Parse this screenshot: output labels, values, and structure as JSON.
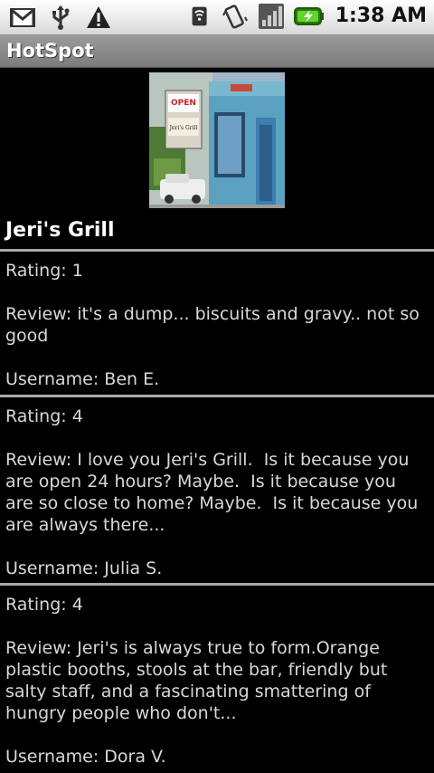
{
  "status_bar": {
    "icons": [
      "gmail-icon",
      "usb-icon",
      "warning-icon",
      "wifi-icon",
      "vibrate-icon",
      "signal-icon",
      "battery-icon"
    ],
    "time": "1:38 AM"
  },
  "app": {
    "title": "HotSpot"
  },
  "place": {
    "name": "Jeri's Grill",
    "photo_sign_1": "OPEN",
    "photo_sign_2": "Jeri's Grill"
  },
  "reviews": [
    {
      "rating": "Rating: 1",
      "review": "Review: it's a dump... biscuits and gravy.. not so good",
      "username": "Username: Ben E."
    },
    {
      "rating": "Rating: 4",
      "review": "Review: I love you Jeri's Grill.  Is it because you are open 24 hours? Maybe.  Is it because you are so close to home? Maybe.  Is it because you are always there...",
      "username": "Username: Julia S."
    },
    {
      "rating": "Rating: 4",
      "review": "Review: Jeri's is always true to form.Orange plastic booths, stools at the bar, friendly but salty staff, and a fascinating smattering of hungry people who don't...",
      "username": "Username: Dora V."
    }
  ],
  "colors": {
    "background": "#000000",
    "title_bar": "#8a8a8a",
    "divider": "#a8a8a8",
    "text": "#d8d8d8",
    "battery_green": "#4caf20"
  }
}
